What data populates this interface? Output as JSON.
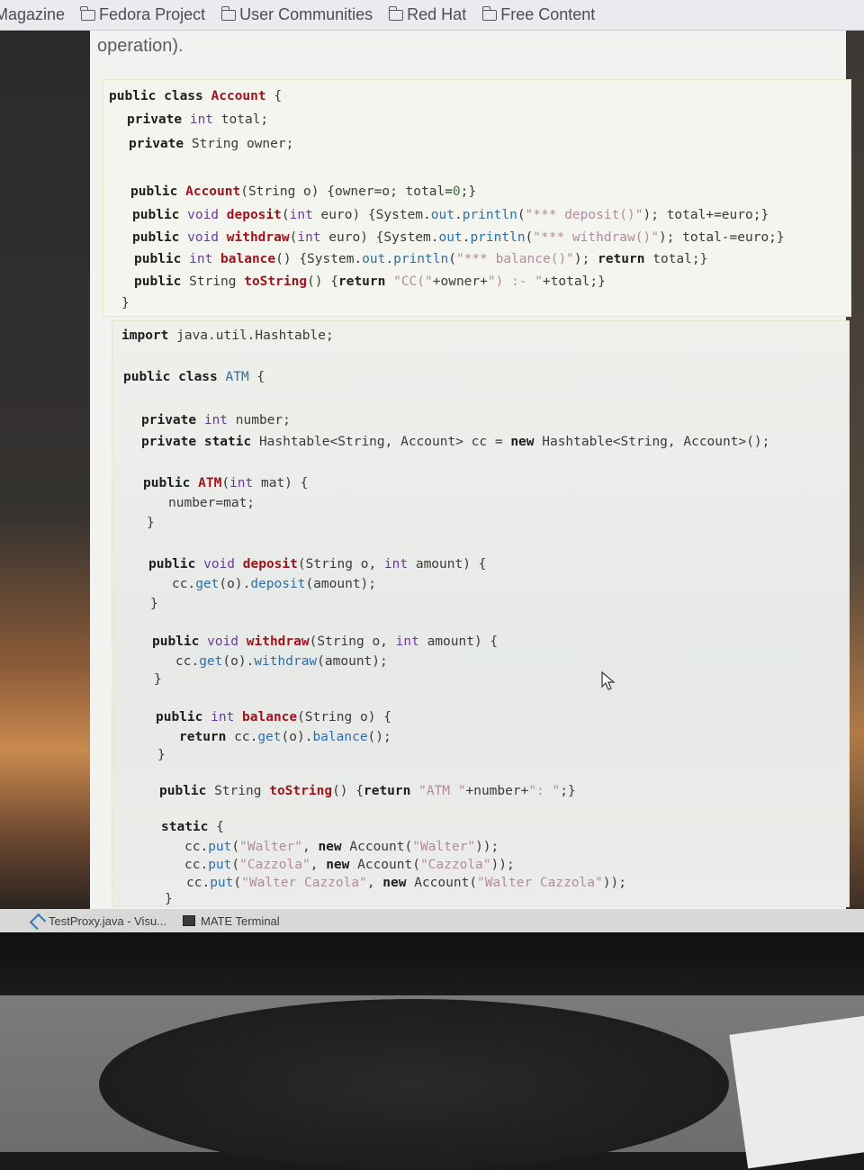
{
  "bookmarks": {
    "items": [
      {
        "label": "Magazine"
      },
      {
        "label": "Fedora Project"
      },
      {
        "label": "User Communities"
      },
      {
        "label": "Red Hat"
      },
      {
        "label": "Free Content"
      }
    ]
  },
  "page": {
    "intro_text": "operation).",
    "account_code": [
      "public class Account {",
      "  private int total;",
      "  private String owner;",
      "",
      "  public Account(String o) {owner=o; total=0;}",
      "  public void deposit(int euro) {System.out.println(\"*** deposit()\"); total+=euro;}",
      "  public void withdraw(int euro) {System.out.println(\"*** withdraw()\"); total-=euro;}",
      "  public int balance() {System.out.println(\"*** balance()\"); return total;}",
      "  public String toString() {return \"CC(\"+owner+\") :- \"+total;}",
      "}"
    ],
    "atm_code": [
      "import java.util.Hashtable;",
      "",
      "public class ATM {",
      "",
      "  private int number;",
      "  private static Hashtable<String, Account> cc = new Hashtable<String, Account>();",
      "",
      "  public ATM(int mat) {",
      "    number=mat;",
      "  }",
      "",
      "  public void deposit(String o, int amount) {",
      "    cc.get(o).deposit(amount);",
      "  }",
      "",
      "  public void withdraw(String o, int amount) {",
      "    cc.get(o).withdraw(amount);",
      "  }",
      "",
      "  public int balance(String o) {",
      "    return cc.get(o).balance();",
      "  }",
      "",
      "  public String toString() {return \"ATM \"+number+\": \";}",
      "",
      "  static {",
      "    cc.put(\"Walter\", new Account(\"Walter\"));",
      "    cc.put(\"Cazzola\", new Account(\"Cazzola\"));",
      "    cc.put(\"Walter Cazzola\", new Account(\"Walter Cazzola\"));",
      "  }"
    ]
  },
  "taskbar": {
    "items": [
      {
        "label": "TestProxy.java - Visu...",
        "icon": "vscode-icon"
      },
      {
        "label": "MATE Terminal",
        "icon": "terminal-icon"
      }
    ]
  }
}
